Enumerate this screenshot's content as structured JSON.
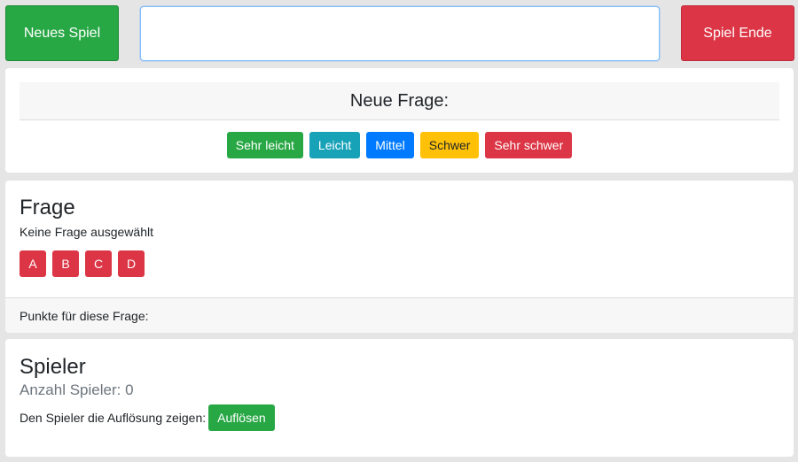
{
  "top_bar": {
    "new_game_label": "Neues Spiel",
    "name_input_value": "",
    "end_game_label": "Spiel Ende"
  },
  "question_select": {
    "header": "Neue Frage:",
    "difficulties": [
      {
        "label": "Sehr leicht",
        "color": "#28a745"
      },
      {
        "label": "Leicht",
        "color": "#17a2b8"
      },
      {
        "label": "Mittel",
        "color": "#007bff"
      },
      {
        "label": "Schwer",
        "color": "#ffc107"
      },
      {
        "label": "Sehr schwer",
        "color": "#dc3545"
      }
    ]
  },
  "question": {
    "title": "Frage",
    "text": "Keine Frage ausgewählt",
    "answers": [
      "A",
      "B",
      "C",
      "D"
    ],
    "points_label": "Punkte für diese Frage:"
  },
  "player": {
    "title": "Spieler",
    "count_text": "Anzahl Spieler: 0",
    "reveal_prompt": "Den Spieler die Auflösung zeigen:",
    "reveal_button_label": "Auflösen"
  }
}
